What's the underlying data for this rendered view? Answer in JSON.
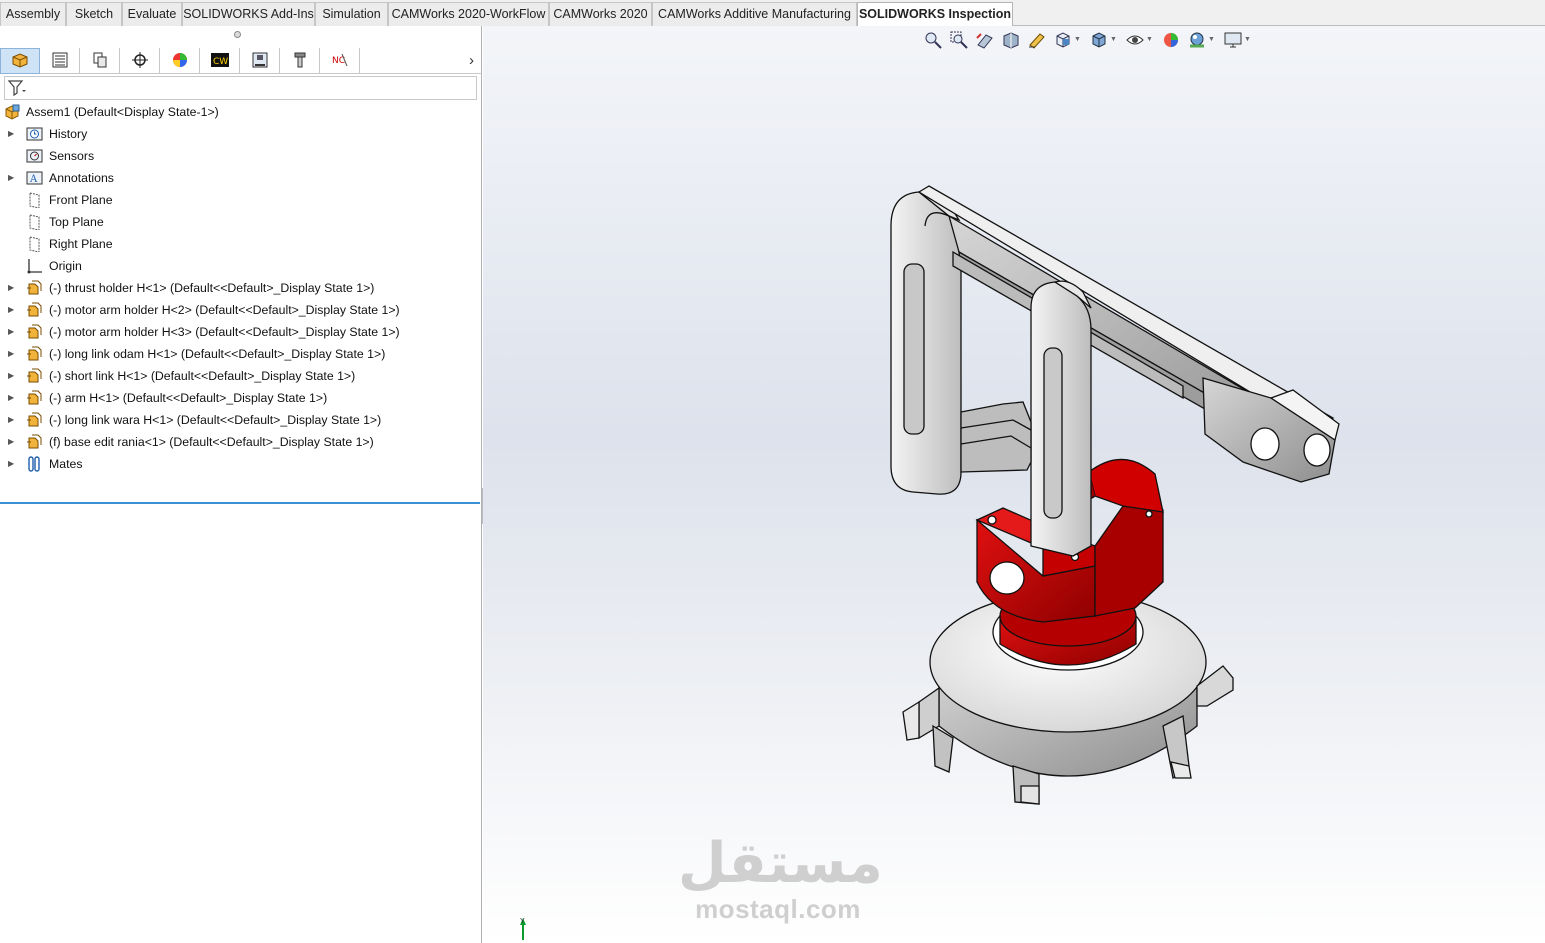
{
  "ribbon": {
    "tabs": [
      {
        "label": "Assembly"
      },
      {
        "label": "Sketch"
      },
      {
        "label": "Evaluate"
      },
      {
        "label": "SOLIDWORKS Add-Ins"
      },
      {
        "label": "Simulation"
      },
      {
        "label": "CAMWorks 2020-WorkFlow"
      },
      {
        "label": "CAMWorks 2020"
      },
      {
        "label": "CAMWorks Additive Manufacturing"
      },
      {
        "label": "SOLIDWORKS Inspection"
      }
    ],
    "active_tab": "SOLIDWORKS Inspection"
  },
  "manager_tabs": [
    {
      "icon": "featuremanager-icon",
      "active": true
    },
    {
      "icon": "propertymanager-icon"
    },
    {
      "icon": "configurationmanager-icon"
    },
    {
      "icon": "dimxpertmanager-icon"
    },
    {
      "icon": "displaymanager-icon"
    },
    {
      "icon": "camworks-feature-tree-icon"
    },
    {
      "icon": "camworks-operation-tree-icon"
    },
    {
      "icon": "camworks-tool-tree-icon"
    },
    {
      "icon": "camworks-nc-manager-icon"
    }
  ],
  "tree": {
    "root": {
      "label": "Assem1  (Default<Display State-1>)",
      "icon": "assembly-icon"
    },
    "items": [
      {
        "label": "History",
        "icon": "history-icon",
        "expandable": true
      },
      {
        "label": "Sensors",
        "icon": "sensors-icon",
        "expandable": false
      },
      {
        "label": "Annotations",
        "icon": "annotations-icon",
        "expandable": true
      },
      {
        "label": "Front Plane",
        "icon": "plane-icon",
        "expandable": false
      },
      {
        "label": "Top Plane",
        "icon": "plane-icon",
        "expandable": false
      },
      {
        "label": "Right Plane",
        "icon": "plane-icon",
        "expandable": false
      },
      {
        "label": "Origin",
        "icon": "origin-icon",
        "expandable": false
      },
      {
        "label": "(-) thrust holder H<1> (Default<<Default>_Display State 1>)",
        "icon": "part-icon",
        "expandable": true
      },
      {
        "label": "(-) motor arm holder H<2> (Default<<Default>_Display State 1>)",
        "icon": "part-icon",
        "expandable": true
      },
      {
        "label": "(-) motor arm holder H<3> (Default<<Default>_Display State 1>)",
        "icon": "part-icon",
        "expandable": true
      },
      {
        "label": "(-) long link odam H<1> (Default<<Default>_Display State 1>)",
        "icon": "part-icon",
        "expandable": true
      },
      {
        "label": "(-) short link H<1> (Default<<Default>_Display State 1>)",
        "icon": "part-icon",
        "expandable": true
      },
      {
        "label": "(-) arm H<1> (Default<<Default>_Display State 1>)",
        "icon": "part-icon",
        "expandable": true
      },
      {
        "label": "(-) long link wara H<1> (Default<<Default>_Display State 1>)",
        "icon": "part-icon",
        "expandable": true
      },
      {
        "label": "(f) base edit rania<1> (Default<<Default>_Display State 1>)",
        "icon": "part-icon",
        "expandable": true
      },
      {
        "label": "Mates",
        "icon": "mates-icon",
        "expandable": true
      }
    ]
  },
  "heads_up_toolbar": [
    {
      "icon": "zoom-to-fit-icon"
    },
    {
      "icon": "zoom-to-area-icon"
    },
    {
      "icon": "previous-view-icon"
    },
    {
      "icon": "section-view-icon"
    },
    {
      "icon": "dynamic-annotation-views-icon"
    },
    {
      "icon": "view-orientation-icon",
      "dropdown": true
    },
    {
      "icon": "display-style-icon",
      "dropdown": true
    },
    {
      "icon": "hide-show-items-icon",
      "dropdown": true
    },
    {
      "icon": "edit-appearance-icon"
    },
    {
      "icon": "apply-scene-icon",
      "dropdown": true
    },
    {
      "icon": "view-settings-icon",
      "dropdown": true
    }
  ],
  "colors": {
    "accent_blue": "#3b8fd6",
    "part_red": "#cc0000",
    "part_gray": "#b8b8b8",
    "part_white": "#f2f2f2"
  },
  "triad": {
    "axis_label": "Y"
  },
  "watermark": {
    "arabic": "مستقل",
    "latin": "mostaql.com"
  }
}
